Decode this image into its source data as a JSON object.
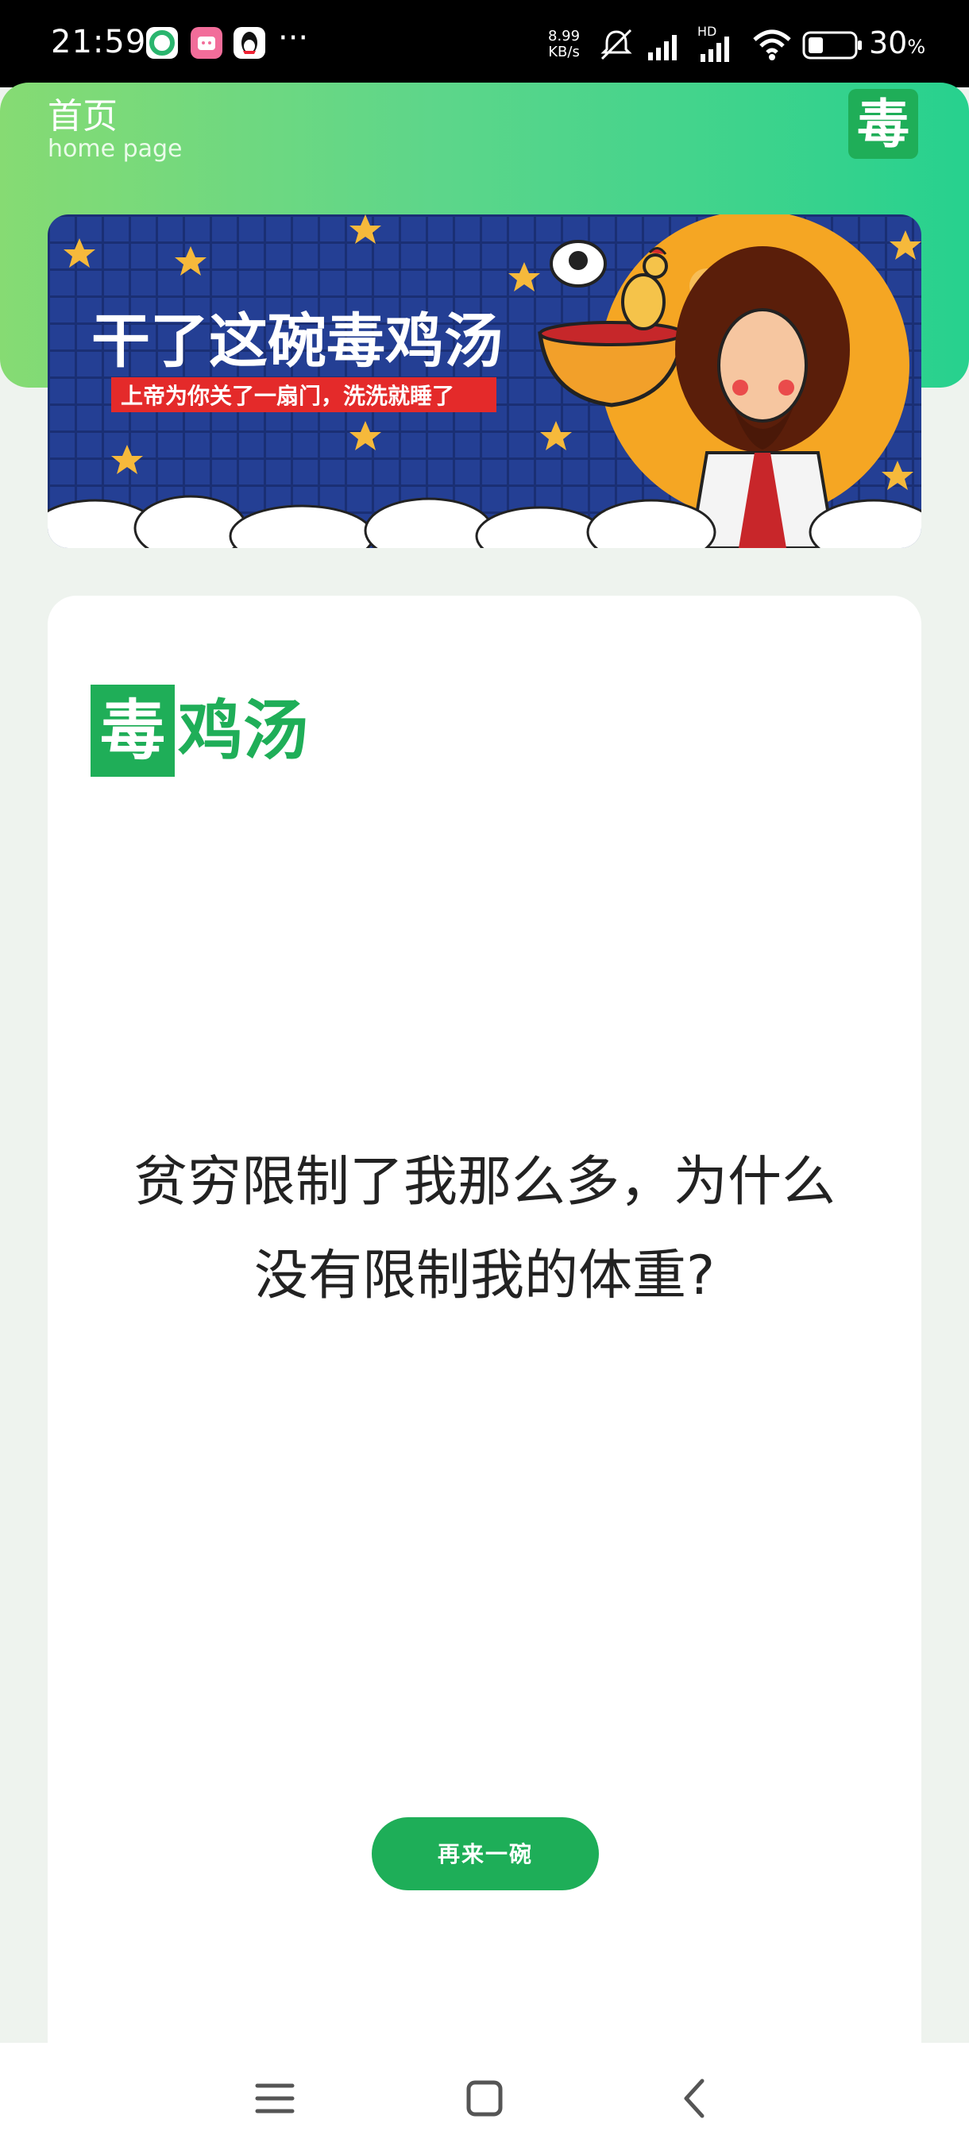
{
  "status_bar": {
    "time": "21:59",
    "apps": [
      "app-icon-1",
      "app-icon-2",
      "qq-icon"
    ],
    "more": "···",
    "net_speed_value": "8.99",
    "net_speed_unit": "KB/s",
    "network": "HD",
    "battery_percent": "30",
    "battery_unit": "%"
  },
  "header": {
    "title": "首页",
    "subtitle": "home page",
    "logo_char": "毒"
  },
  "banner": {
    "headline": "干了这碗毒鸡汤",
    "tagline": "上帝为你关了一扇门，洗洗就睡了"
  },
  "card": {
    "logo_box_char": "毒",
    "logo_text": "鸡汤",
    "quote_line1": "贫穷限制了我那么多，为什么",
    "quote_line2": "没有限制我的体重?",
    "button_label": "再来一碗"
  },
  "navbar": {
    "items": [
      "menu-icon",
      "home-icon",
      "back-icon"
    ]
  },
  "colors": {
    "brand_green": "#1fae58",
    "header_start": "#86db73",
    "header_end": "#27d18e",
    "banner_bg": "#1f3c8e"
  }
}
